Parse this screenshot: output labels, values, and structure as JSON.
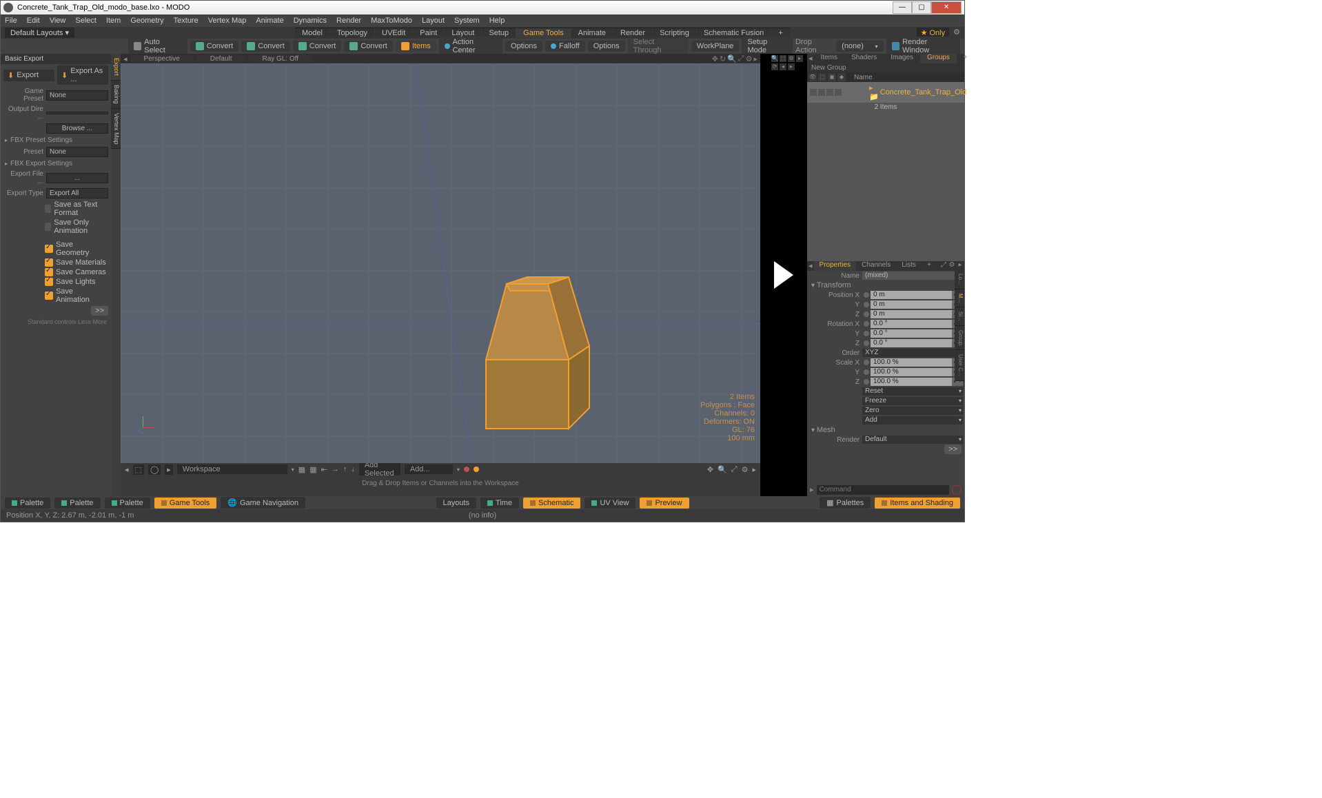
{
  "window": {
    "title": "Concrete_Tank_Trap_Old_modo_base.lxo - MODO"
  },
  "menubar": [
    "File",
    "Edit",
    "View",
    "Select",
    "Item",
    "Geometry",
    "Texture",
    "Vertex Map",
    "Animate",
    "Dynamics",
    "Render",
    "MaxToModo",
    "Layout",
    "System",
    "Help"
  ],
  "layoutbar": {
    "default": "Default Layouts ▾",
    "tabs": [
      "Model",
      "Topology",
      "UVEdit",
      "Paint",
      "Layout",
      "Setup",
      "Game Tools",
      "Animate",
      "Render",
      "Scripting",
      "Schematic Fusion"
    ],
    "active_tab": "Game Tools",
    "only": "Only"
  },
  "toolbar": {
    "auto_select": "Auto Select",
    "convert": "Convert",
    "items": "Items",
    "action_center": "Action Center",
    "options": "Options",
    "falloff": "Falloff",
    "select_through": "Select Through",
    "workplane": "WorkPlane",
    "setup_mode": "Setup Mode",
    "drop_action": "Drop Action",
    "drop_value": "(none)",
    "render_window": "Render Window"
  },
  "left_panel": {
    "tabs": [
      "Export",
      "Baking",
      "Vertex Map"
    ],
    "title": "Basic Export",
    "export": "Export",
    "export_as": "Export As ...",
    "game_preset_lbl": "Game Preset",
    "game_preset_val": "None",
    "output_dir_lbl": "Output Dire ...",
    "browse": "Browse ...",
    "fbx_preset_hdr": "FBX Preset Settings",
    "preset_lbl": "Preset",
    "preset_val": "None",
    "fbx_export_hdr": "FBX Export Settings",
    "export_file_lbl": "Export File ...",
    "export_file_val": "...",
    "export_type_lbl": "Export Type",
    "export_type_val": "Export All",
    "save_text_format": "Save as Text Format",
    "save_only_anim": "Save Only Animation",
    "save_geom": "Save Geometry",
    "save_mat": "Save Materials",
    "save_cam": "Save Cameras",
    "save_lights": "Save Lights",
    "save_anim": "Save Animation",
    "more_btn": ">>",
    "std_controls": "Standard controls  Less   More"
  },
  "viewport": {
    "tabs": [
      "Perspective",
      "Default",
      "Ray GL: Off"
    ],
    "info": {
      "items": "2 Items",
      "polys": "Polygons : Face",
      "channels": "Channels: 0",
      "deformers": "Deformers: ON",
      "gl": "GL: 76",
      "grid": "100 mm"
    }
  },
  "schematic": {
    "workspace": "Workspace",
    "add_selected": "Add Selected",
    "add": "Add...",
    "drop_hint": "Drag & Drop Items or Channels into the Workspace"
  },
  "right_panel": {
    "tabs1": [
      "Items",
      "Shaders",
      "Images",
      "Groups"
    ],
    "active_tab1": "Groups",
    "new_group": "New Group",
    "name_col": "Name",
    "item_name": "Concrete_Tank_Trap_Old",
    "item_count": "2 Items",
    "tabs2": [
      "Properties",
      "Channels",
      "Lists"
    ],
    "active_tab2": "Properties",
    "name_lbl": "Name",
    "name_val": "(mixed)",
    "transform_hdr": "Transform",
    "pos_x_lbl": "Position X",
    "pos_x": "0 m",
    "y_lbl": "Y",
    "pos_y": "0 m",
    "z_lbl": "Z",
    "pos_z": "0 m",
    "rot_x_lbl": "Rotation X",
    "rot_x": "0.0 °",
    "rot_y": "0.0 °",
    "rot_z": "0.0 °",
    "order_lbl": "Order",
    "order_val": "XYZ",
    "scale_x_lbl": "Scale X",
    "scale_x": "100.0 %",
    "scale_y": "100.0 %",
    "scale_z": "100.0 %",
    "reset": "Reset",
    "freeze": "Freeze",
    "zero": "Zero",
    "add": "Add",
    "mesh_hdr": "Mesh",
    "render_lbl": "Render",
    "render_val": "Default",
    "more_btn": ">>",
    "cmd_placeholder": "Command",
    "side_tabs": [
      "Lo...",
      "M...",
      "Si...",
      "Group",
      "User C..."
    ]
  },
  "footer": {
    "palette": "Palette",
    "game_tools": "Game Tools",
    "game_nav": "Game Navigation",
    "layouts": "Layouts",
    "time": "Time",
    "schematic": "Schematic",
    "uv_view": "UV View",
    "preview": "Preview",
    "palettes": "Palettes",
    "items_shading": "Items and Shading"
  },
  "statusbar": {
    "pos": "Position X, Y, Z:    2.67 m, -2.01 m, -1 m",
    "center": "(no info)"
  }
}
